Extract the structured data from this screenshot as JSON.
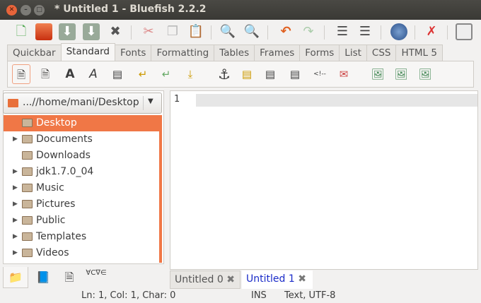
{
  "window": {
    "title": "* Untitled 1 - Bluefish 2.2.2"
  },
  "toolbar": {
    "icons": [
      "new-file",
      "open-file",
      "save",
      "save-as",
      "close",
      "cut",
      "copy",
      "paste",
      "find",
      "find-replace",
      "undo",
      "redo",
      "unindent",
      "indent",
      "preview-browser",
      "preferences",
      "fullscreen"
    ]
  },
  "tabs": [
    "Quickbar",
    "Standard",
    "Fonts",
    "Formatting",
    "Tables",
    "Frames",
    "Forms",
    "List",
    "CSS",
    "HTML 5"
  ],
  "active_tab": "Standard",
  "standard_icons": [
    "quickstart",
    "body",
    "bold",
    "italic",
    "paragraph",
    "break",
    "break-clear",
    "nbsp",
    "anchor",
    "rule",
    "center",
    "right-align",
    "comment",
    "email",
    "insert-image",
    "thumbnail",
    "multi-thumbnail"
  ],
  "filebrowser": {
    "path": "...//home/mani/Desktop",
    "items": [
      {
        "label": "Desktop",
        "expandable": false,
        "selected": true
      },
      {
        "label": "Documents",
        "expandable": true
      },
      {
        "label": "Downloads",
        "expandable": false
      },
      {
        "label": "jdk1.7.0_04",
        "expandable": true
      },
      {
        "label": "Music",
        "expandable": true
      },
      {
        "label": "Pictures",
        "expandable": true
      },
      {
        "label": "Public",
        "expandable": true
      },
      {
        "label": "Templates",
        "expandable": true
      },
      {
        "label": "Videos",
        "expandable": true
      }
    ]
  },
  "editor": {
    "line_number": "1"
  },
  "doc_tabs": [
    {
      "label": "Untitled 0",
      "active": false
    },
    {
      "label": "Untitled 1",
      "active": true
    }
  ],
  "side_tab_chars": "∀C∇∈",
  "status": {
    "position": "Ln: 1, Col: 1, Char: 0",
    "mode": "INS",
    "encoding": "Text, UTF-8"
  }
}
